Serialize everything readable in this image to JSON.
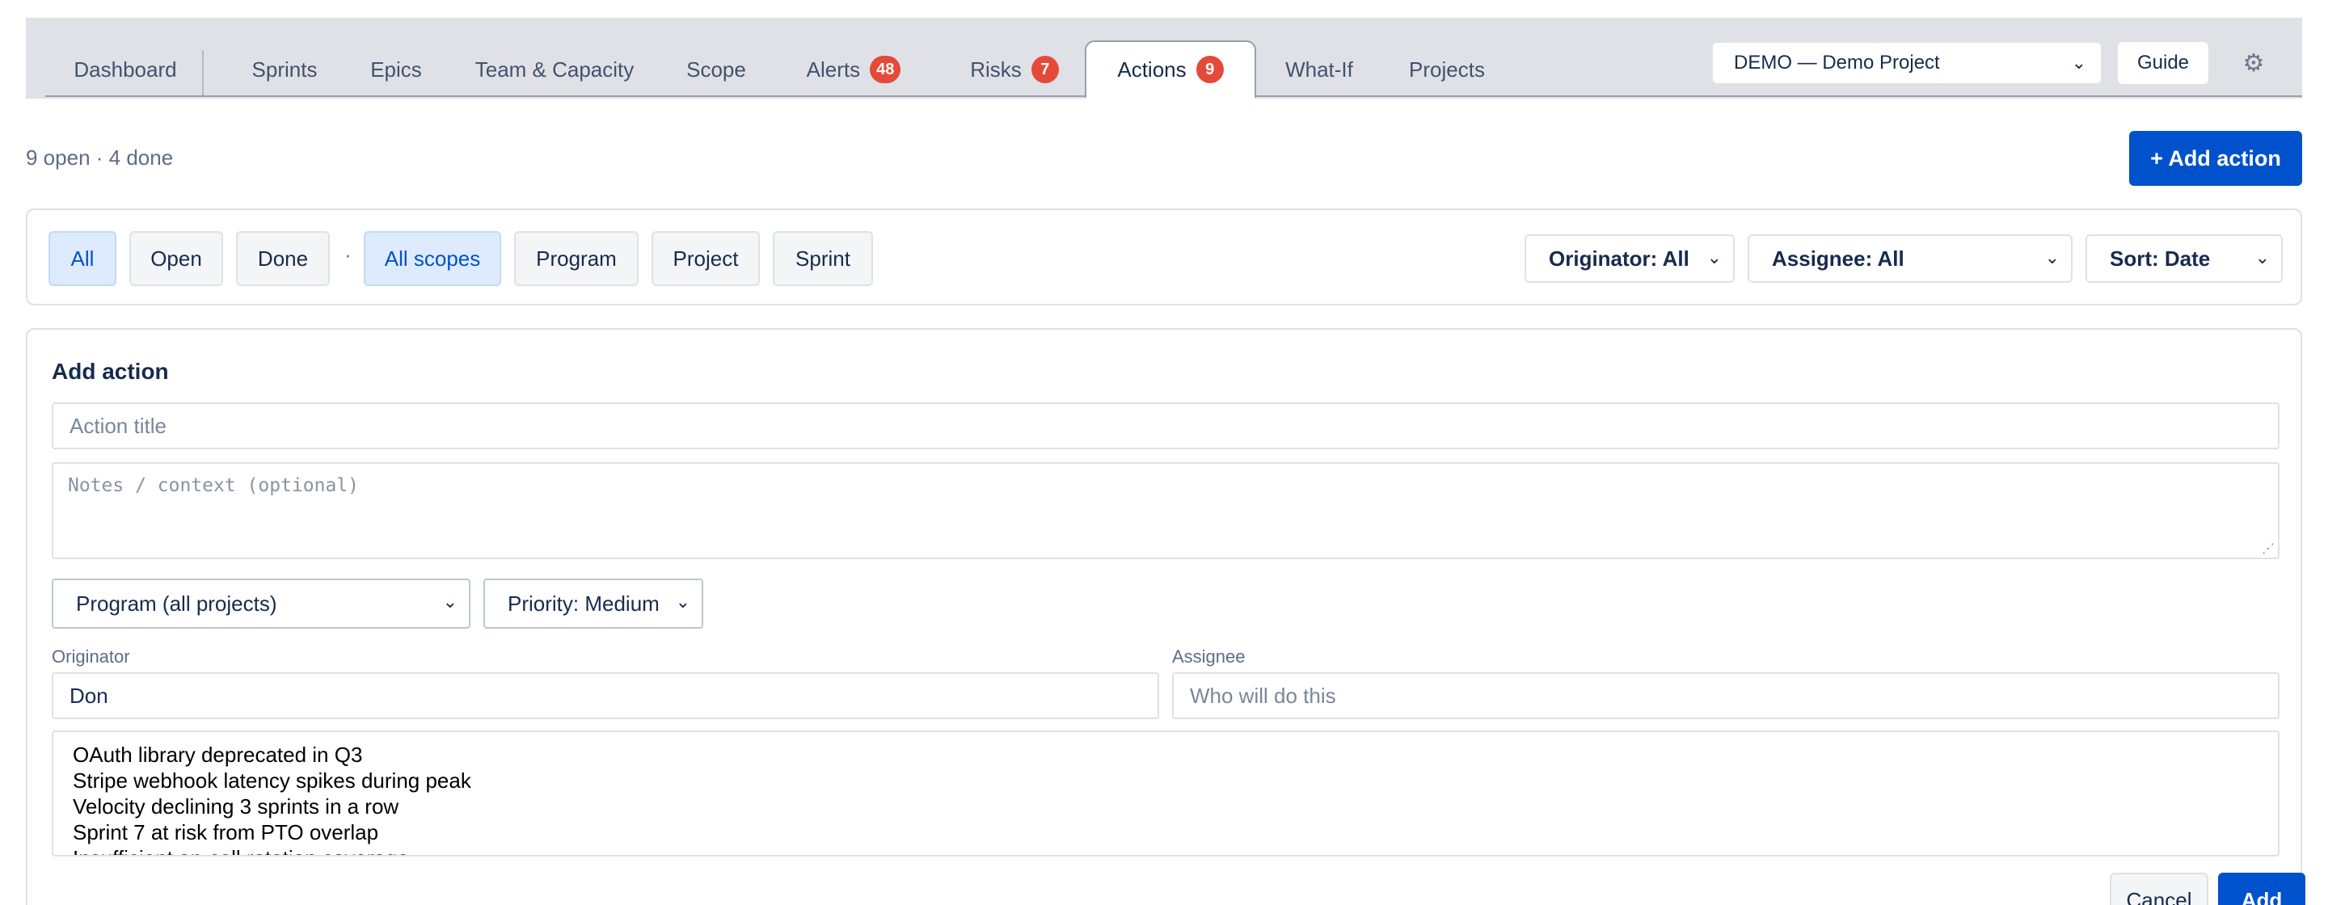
{
  "nav": {
    "tabs": [
      {
        "label": "Dashboard"
      },
      {
        "label": "Sprints"
      },
      {
        "label": "Epics"
      },
      {
        "label": "Team & Capacity"
      },
      {
        "label": "Scope"
      },
      {
        "label": "Alerts",
        "badge": "48"
      },
      {
        "label": "Risks",
        "badge": "7"
      },
      {
        "label": "Actions",
        "badge": "9",
        "active": true
      },
      {
        "label": "What-If"
      },
      {
        "label": "Projects"
      }
    ],
    "project_select": "DEMO — Demo Project",
    "guide_label": "Guide",
    "settings_icon": "gear-icon"
  },
  "summary": "9 open · 4 done",
  "add_action_button": "+ Add action",
  "filters": {
    "status": [
      "All",
      "Open",
      "Done"
    ],
    "separator": "·",
    "scopes": [
      "All scopes",
      "Program",
      "Project",
      "Sprint"
    ],
    "originator": "Originator: All",
    "assignee": "Assignee: All",
    "sort": "Sort: Date"
  },
  "form": {
    "title": "Add action",
    "title_placeholder": "Action title",
    "notes_placeholder": "Notes / context (optional)",
    "scope_select": "Program (all projects)",
    "priority_select": "Priority: Medium",
    "originator_label": "Originator",
    "originator_value": "Don",
    "assignee_label": "Assignee",
    "assignee_placeholder": "Who will do this",
    "linked_items": [
      "OAuth library deprecated in Q3",
      "Stripe webhook latency spikes during peak",
      "Velocity declining 3 sprints in a row",
      "Sprint 7 at risk from PTO overlap",
      "Insufficient on-call rotation coverage"
    ],
    "cancel_label": "Cancel",
    "add_label": "Add"
  },
  "colors": {
    "primary": "#0052cc",
    "badge": "#e5493a",
    "selected_chip_bg": "#deebff",
    "nav_bg": "#dfe1e6"
  }
}
